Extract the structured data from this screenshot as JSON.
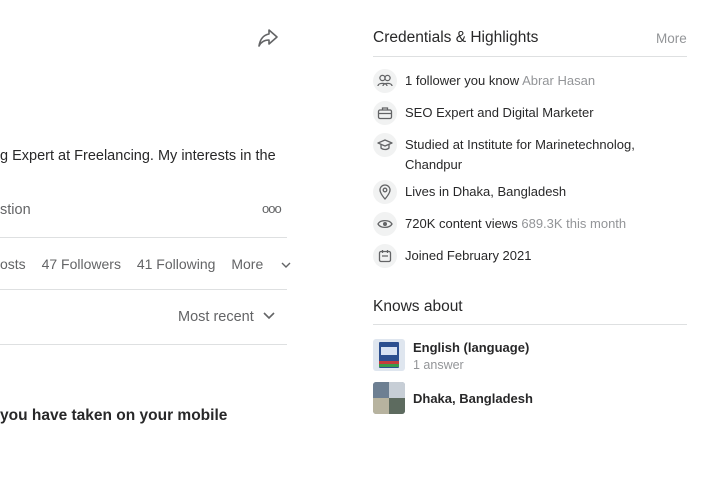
{
  "profile": {
    "bio_fragment": "g Expert at Freelancing. My interests in the",
    "tab_partial": "stion",
    "more_options_glyph": "ooo",
    "stats": {
      "posts_partial": "osts",
      "followers": "47 Followers",
      "following": "41 Following",
      "more": "More"
    },
    "sort_label": "Most recent",
    "post_title_partial": "you have taken on your mobile"
  },
  "credentials": {
    "title": "Credentials & Highlights",
    "more": "More",
    "items": [
      {
        "icon": "people-icon",
        "text": "1 follower you know",
        "secondary": "Abrar Hasan"
      },
      {
        "icon": "briefcase-icon",
        "text": "SEO Expert and Digital Marketer",
        "secondary": ""
      },
      {
        "icon": "graduation-cap-icon",
        "text": "Studied at Institute for Marinetechnolog,",
        "text2": "Chandpur",
        "secondary": ""
      },
      {
        "icon": "location-pin-icon",
        "text": "Lives in Dhaka, Bangladesh",
        "secondary": ""
      },
      {
        "icon": "eye-icon",
        "text": "720K content views",
        "secondary": "689.3K this month"
      },
      {
        "icon": "calendar-icon",
        "text": "Joined February 2021",
        "secondary": ""
      }
    ]
  },
  "knows_about": {
    "title": "Knows about",
    "topics": [
      {
        "name": "English (language)",
        "sub": "1 answer"
      },
      {
        "name": "Dhaka, Bangladesh",
        "sub": ""
      }
    ]
  },
  "colors": {
    "text": "#282829",
    "muted": "#636466",
    "light": "#939598",
    "divider": "#dee0e1"
  }
}
